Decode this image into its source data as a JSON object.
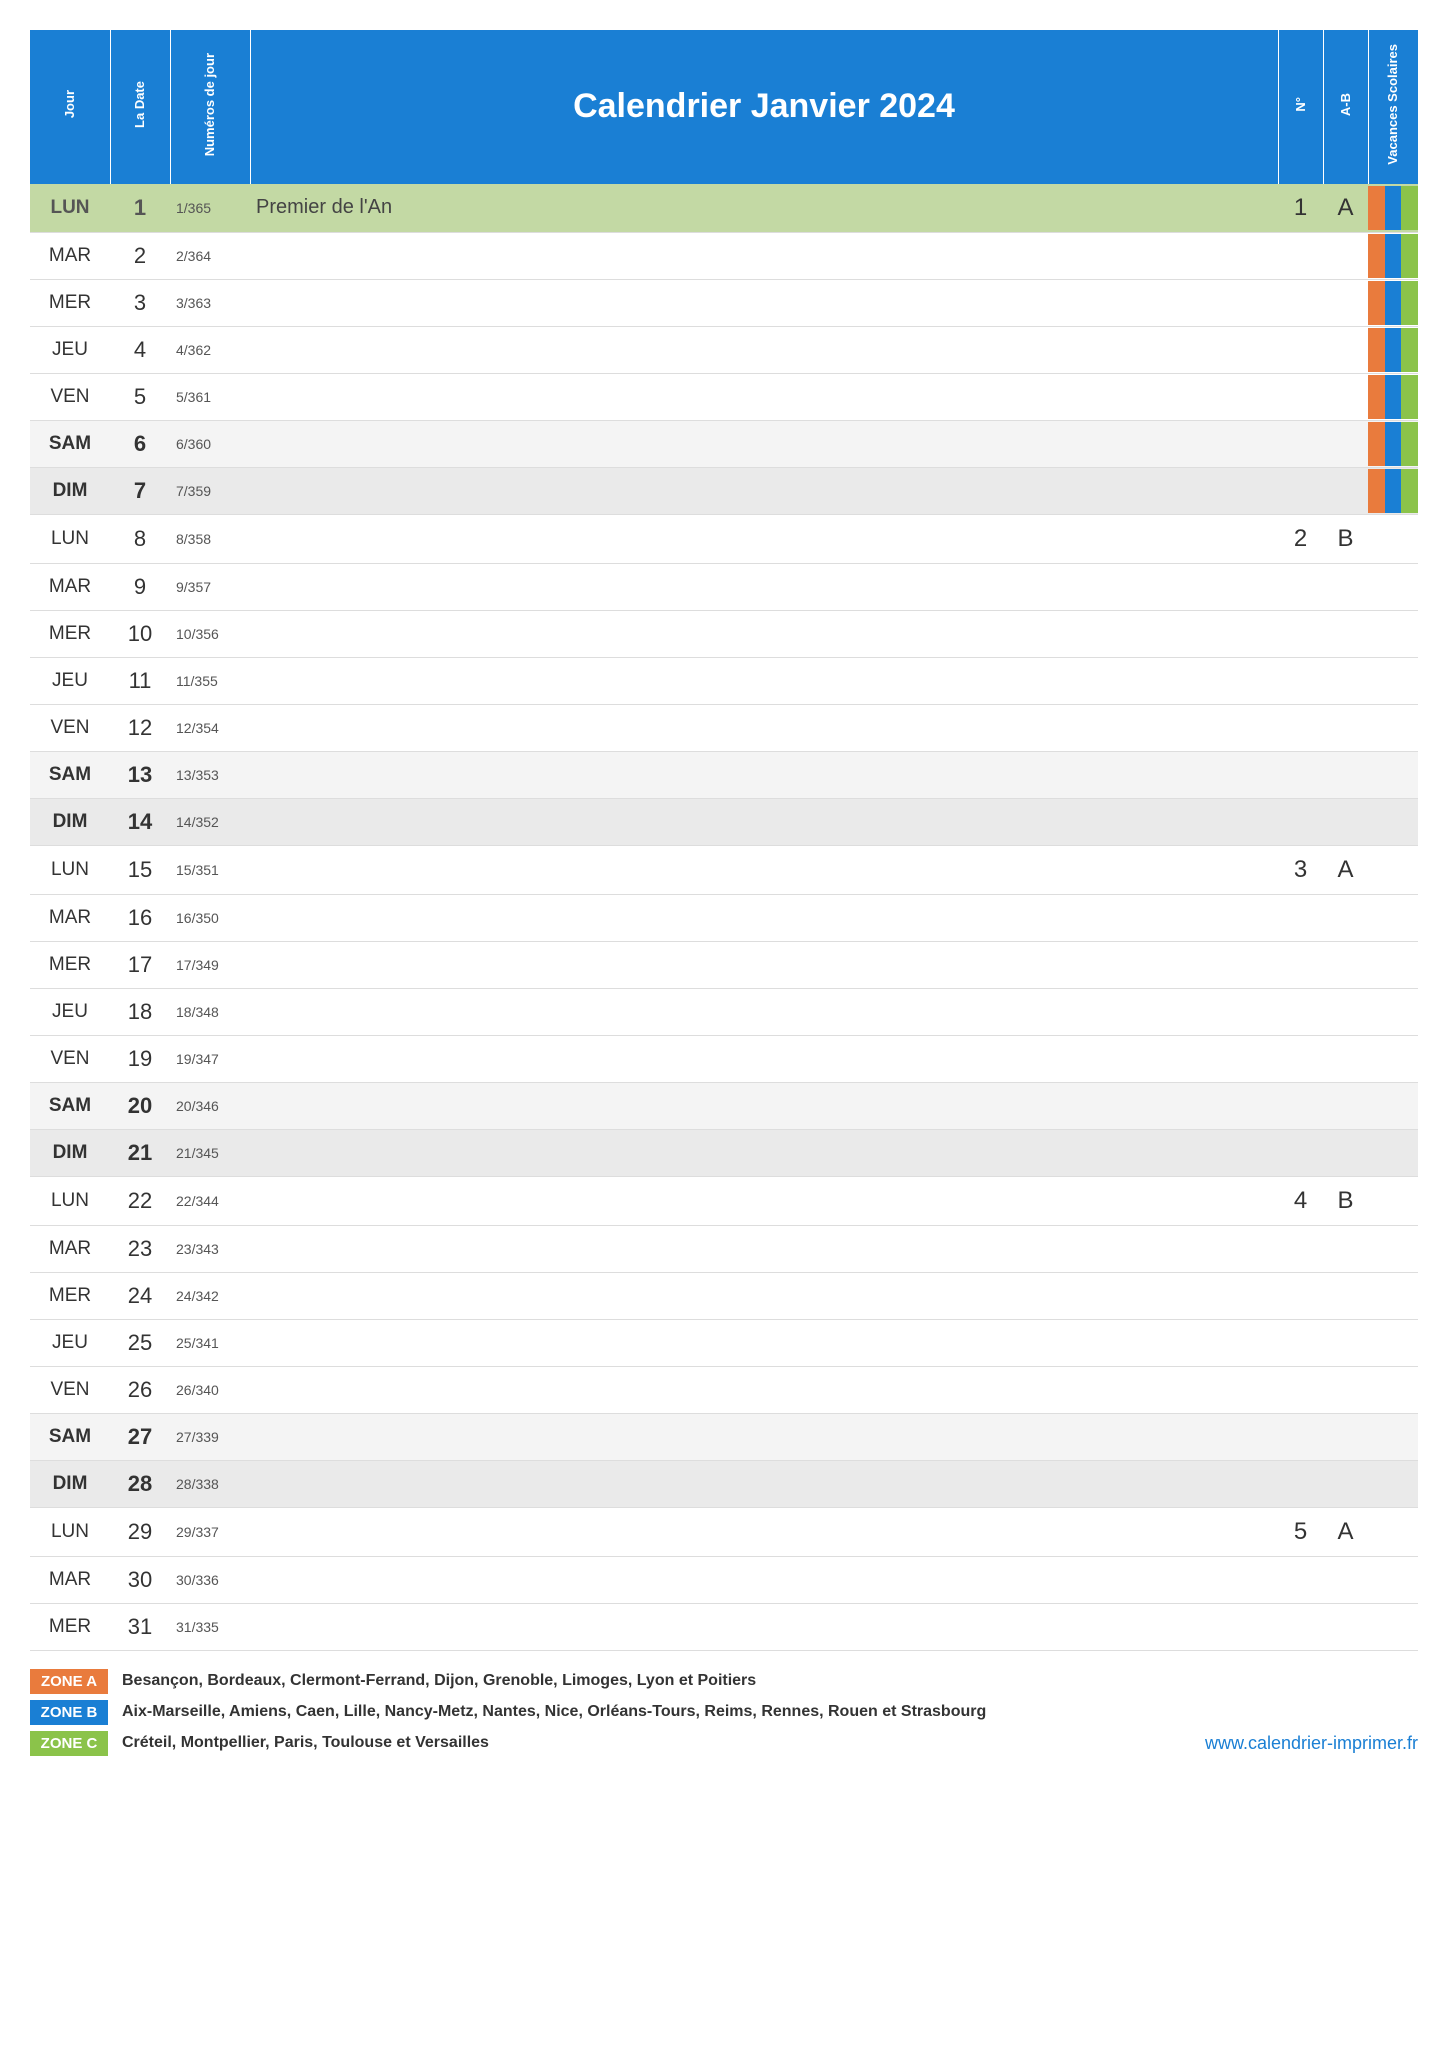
{
  "title": "Calendrier Janvier 2024",
  "headers": {
    "jour": "Jour",
    "date": "La Date",
    "numero": "Numéros de jour",
    "n": "N°",
    "ab": "A-B",
    "vac": "Vacances Scolaires"
  },
  "zones_colors": {
    "A": "#e97b3d",
    "B": "#1a7fd4",
    "C": "#8bc34a"
  },
  "days": [
    {
      "dow": "LUN",
      "d": "1",
      "dn": "1/365",
      "event": "Premier de l'An",
      "n": "1",
      "ab": "A",
      "holiday": true,
      "vac": [
        "A",
        "B",
        "C"
      ]
    },
    {
      "dow": "MAR",
      "d": "2",
      "dn": "2/364",
      "event": "",
      "n": "",
      "ab": "",
      "vac": [
        "A",
        "B",
        "C"
      ]
    },
    {
      "dow": "MER",
      "d": "3",
      "dn": "3/363",
      "event": "",
      "n": "",
      "ab": "",
      "vac": [
        "A",
        "B",
        "C"
      ]
    },
    {
      "dow": "JEU",
      "d": "4",
      "dn": "4/362",
      "event": "",
      "n": "",
      "ab": "",
      "vac": [
        "A",
        "B",
        "C"
      ]
    },
    {
      "dow": "VEN",
      "d": "5",
      "dn": "5/361",
      "event": "",
      "n": "",
      "ab": "",
      "vac": [
        "A",
        "B",
        "C"
      ]
    },
    {
      "dow": "SAM",
      "d": "6",
      "dn": "6/360",
      "event": "",
      "n": "",
      "ab": "",
      "sat": true,
      "vac": [
        "A",
        "B",
        "C"
      ]
    },
    {
      "dow": "DIM",
      "d": "7",
      "dn": "7/359",
      "event": "",
      "n": "",
      "ab": "",
      "sun": true,
      "vac": [
        "A",
        "B",
        "C"
      ]
    },
    {
      "dow": "LUN",
      "d": "8",
      "dn": "8/358",
      "event": "",
      "n": "2",
      "ab": "B",
      "vac": []
    },
    {
      "dow": "MAR",
      "d": "9",
      "dn": "9/357",
      "event": "",
      "n": "",
      "ab": "",
      "vac": []
    },
    {
      "dow": "MER",
      "d": "10",
      "dn": "10/356",
      "event": "",
      "n": "",
      "ab": "",
      "vac": []
    },
    {
      "dow": "JEU",
      "d": "11",
      "dn": "11/355",
      "event": "",
      "n": "",
      "ab": "",
      "vac": []
    },
    {
      "dow": "VEN",
      "d": "12",
      "dn": "12/354",
      "event": "",
      "n": "",
      "ab": "",
      "vac": []
    },
    {
      "dow": "SAM",
      "d": "13",
      "dn": "13/353",
      "event": "",
      "n": "",
      "ab": "",
      "sat": true,
      "vac": []
    },
    {
      "dow": "DIM",
      "d": "14",
      "dn": "14/352",
      "event": "",
      "n": "",
      "ab": "",
      "sun": true,
      "vac": []
    },
    {
      "dow": "LUN",
      "d": "15",
      "dn": "15/351",
      "event": "",
      "n": "3",
      "ab": "A",
      "vac": []
    },
    {
      "dow": "MAR",
      "d": "16",
      "dn": "16/350",
      "event": "",
      "n": "",
      "ab": "",
      "vac": []
    },
    {
      "dow": "MER",
      "d": "17",
      "dn": "17/349",
      "event": "",
      "n": "",
      "ab": "",
      "vac": []
    },
    {
      "dow": "JEU",
      "d": "18",
      "dn": "18/348",
      "event": "",
      "n": "",
      "ab": "",
      "vac": []
    },
    {
      "dow": "VEN",
      "d": "19",
      "dn": "19/347",
      "event": "",
      "n": "",
      "ab": "",
      "vac": []
    },
    {
      "dow": "SAM",
      "d": "20",
      "dn": "20/346",
      "event": "",
      "n": "",
      "ab": "",
      "sat": true,
      "vac": []
    },
    {
      "dow": "DIM",
      "d": "21",
      "dn": "21/345",
      "event": "",
      "n": "",
      "ab": "",
      "sun": true,
      "vac": []
    },
    {
      "dow": "LUN",
      "d": "22",
      "dn": "22/344",
      "event": "",
      "n": "4",
      "ab": "B",
      "vac": []
    },
    {
      "dow": "MAR",
      "d": "23",
      "dn": "23/343",
      "event": "",
      "n": "",
      "ab": "",
      "vac": []
    },
    {
      "dow": "MER",
      "d": "24",
      "dn": "24/342",
      "event": "",
      "n": "",
      "ab": "",
      "vac": []
    },
    {
      "dow": "JEU",
      "d": "25",
      "dn": "25/341",
      "event": "",
      "n": "",
      "ab": "",
      "vac": []
    },
    {
      "dow": "VEN",
      "d": "26",
      "dn": "26/340",
      "event": "",
      "n": "",
      "ab": "",
      "vac": []
    },
    {
      "dow": "SAM",
      "d": "27",
      "dn": "27/339",
      "event": "",
      "n": "",
      "ab": "",
      "sat": true,
      "vac": []
    },
    {
      "dow": "DIM",
      "d": "28",
      "dn": "28/338",
      "event": "",
      "n": "",
      "ab": "",
      "sun": true,
      "vac": []
    },
    {
      "dow": "LUN",
      "d": "29",
      "dn": "29/337",
      "event": "",
      "n": "5",
      "ab": "A",
      "vac": []
    },
    {
      "dow": "MAR",
      "d": "30",
      "dn": "30/336",
      "event": "",
      "n": "",
      "ab": "",
      "vac": []
    },
    {
      "dow": "MER",
      "d": "31",
      "dn": "31/335",
      "event": "",
      "n": "",
      "ab": "",
      "vac": []
    }
  ],
  "legend": {
    "A": {
      "label": "ZONE A",
      "text": "Besançon, Bordeaux, Clermont-Ferrand, Dijon, Grenoble, Limoges, Lyon et Poitiers"
    },
    "B": {
      "label": "ZONE B",
      "text": "Aix-Marseille, Amiens, Caen, Lille, Nancy-Metz, Nantes, Nice, Orléans-Tours, Reims, Rennes, Rouen et Strasbourg"
    },
    "C": {
      "label": "ZONE C",
      "text": "Créteil, Montpellier, Paris, Toulouse et Versailles"
    }
  },
  "url": "www.calendrier-imprimer.fr"
}
